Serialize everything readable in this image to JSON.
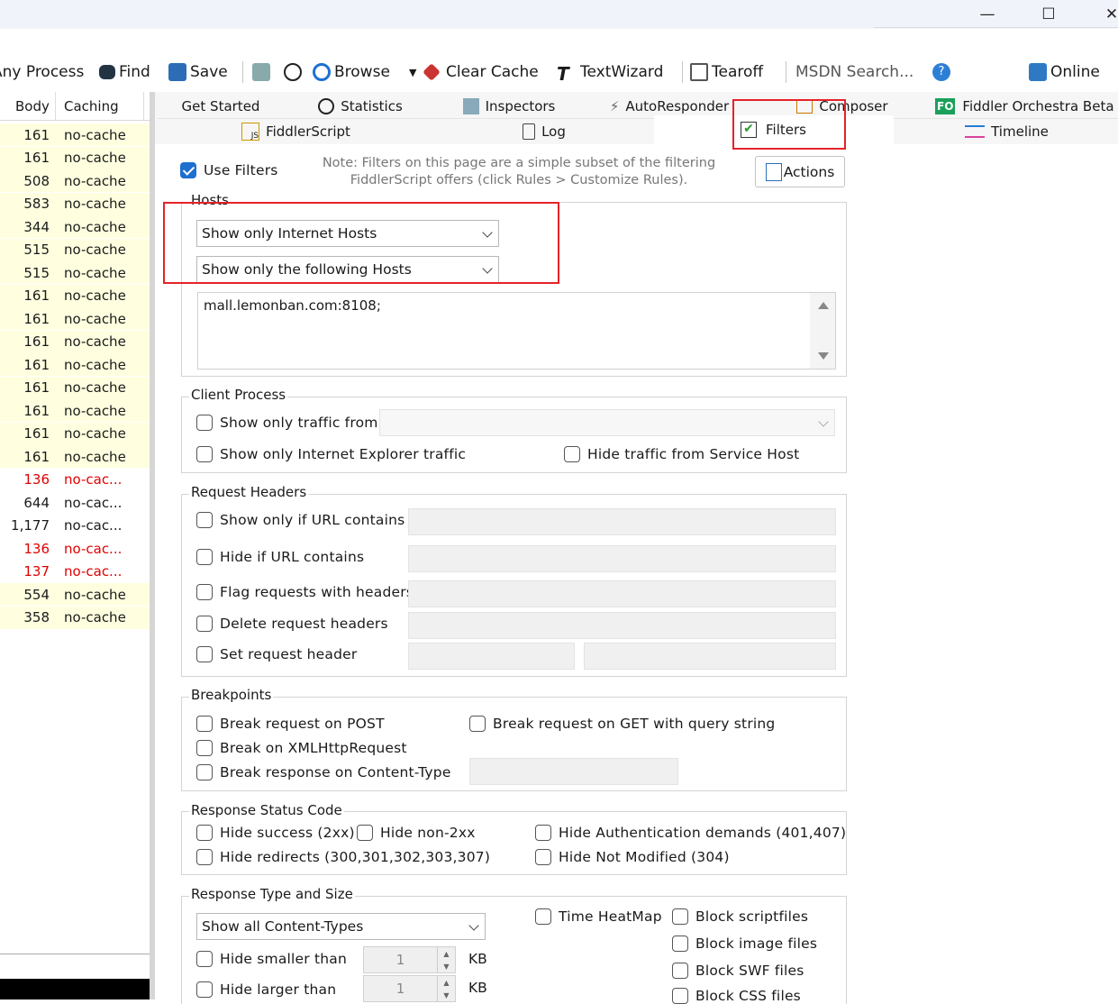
{
  "window": {
    "minimize_icon": "minimize-icon",
    "maximize_icon": "maximize-icon",
    "close_icon": "close-icon"
  },
  "toolbar": {
    "any_process": "Any Process",
    "find": "Find",
    "save": "Save",
    "browse": "Browse",
    "clear_cache": "Clear Cache",
    "textwizard": "TextWizard",
    "tearoff": "Tearoff",
    "msdn_search": "MSDN Search...",
    "online": "Online"
  },
  "sessions": {
    "columns": [
      "Body",
      "Caching"
    ],
    "rows": [
      {
        "body": "161",
        "caching": "no-cache",
        "style": "yellow"
      },
      {
        "body": "161",
        "caching": "no-cache",
        "style": "yellow"
      },
      {
        "body": "508",
        "caching": "no-cache",
        "style": "yellow"
      },
      {
        "body": "583",
        "caching": "no-cache",
        "style": "yellow"
      },
      {
        "body": "344",
        "caching": "no-cache",
        "style": "yellow"
      },
      {
        "body": "515",
        "caching": "no-cache",
        "style": "yellow"
      },
      {
        "body": "515",
        "caching": "no-cache",
        "style": "yellow"
      },
      {
        "body": "161",
        "caching": "no-cache",
        "style": "yellow"
      },
      {
        "body": "161",
        "caching": "no-cache",
        "style": "yellow"
      },
      {
        "body": "161",
        "caching": "no-cache",
        "style": "yellow"
      },
      {
        "body": "161",
        "caching": "no-cache",
        "style": "yellow"
      },
      {
        "body": "161",
        "caching": "no-cache",
        "style": "yellow"
      },
      {
        "body": "161",
        "caching": "no-cache",
        "style": "yellow"
      },
      {
        "body": "161",
        "caching": "no-cache",
        "style": "yellow"
      },
      {
        "body": "161",
        "caching": "no-cache",
        "style": "yellow"
      },
      {
        "body": "136",
        "caching": "no-cac...",
        "style": "red"
      },
      {
        "body": "644",
        "caching": "no-cac...",
        "style": "plain"
      },
      {
        "body": "1,177",
        "caching": "no-cac...",
        "style": "plain"
      },
      {
        "body": "136",
        "caching": "no-cac...",
        "style": "red"
      },
      {
        "body": "137",
        "caching": "no-cac...",
        "style": "red"
      },
      {
        "body": "554",
        "caching": "no-cache",
        "style": "yellow"
      },
      {
        "body": "358",
        "caching": "no-cache",
        "style": "yellow"
      }
    ]
  },
  "tabs": {
    "row1": [
      "Get Started",
      "Statistics",
      "Inspectors",
      "AutoResponder",
      "Composer",
      "Fiddler Orchestra Beta"
    ],
    "row2": [
      "FiddlerScript",
      "Log",
      "Filters",
      "Timeline"
    ],
    "fo_badge": "FO"
  },
  "filters": {
    "use_filters": "Use Filters",
    "note": "Note: Filters on this page are a simple subset of the filtering FiddlerScript offers (click Rules > Customize Rules).",
    "note_line1": "Note: Filters on this page are a simple subset of the filtering",
    "note_line2": "FiddlerScript offers (click Rules > Customize Rules).",
    "actions": "Actions",
    "hosts": {
      "label": "Hosts",
      "zone": "Show only Internet Hosts",
      "mode": "Show only the following Hosts",
      "list": "mall.lemonban.com:8108;"
    },
    "client_process": {
      "label": "Client Process",
      "show_traffic_from": "Show only traffic from",
      "ie_only": "Show only Internet Explorer traffic",
      "hide_service_host": "Hide traffic from Service Host"
    },
    "request_headers": {
      "label": "Request Headers",
      "url_contains": "Show only if URL contains",
      "hide_url": "Hide if URL contains",
      "flag_headers": "Flag requests with headers",
      "delete_headers": "Delete request headers",
      "set_header": "Set request header"
    },
    "breakpoints": {
      "label": "Breakpoints",
      "post": "Break request on POST",
      "get_query": "Break request on GET with query string",
      "xhr": "Break on XMLHttpRequest",
      "content_type": "Break response on Content-Type"
    },
    "status_code": {
      "label": "Response Status Code",
      "hide_success": "Hide success (2xx)",
      "hide_non2xx": "Hide non-2xx",
      "hide_auth": "Hide Authentication demands (401,407)",
      "hide_redirects": "Hide redirects (300,301,302,303,307)",
      "hide_not_modified": "Hide Not Modified (304)"
    },
    "type_size": {
      "label": "Response Type and Size",
      "content_types": "Show all Content-Types",
      "time_heatmap": "Time HeatMap",
      "block_script": "Block scriptfiles",
      "block_image": "Block image files",
      "block_swf": "Block SWF files",
      "block_css": "Block CSS files",
      "hide_smaller": "Hide smaller than",
      "hide_larger": "Hide larger than",
      "smaller_value": "1",
      "larger_value": "1",
      "unit": "KB"
    }
  },
  "colors": {
    "highlight": "#e5222a",
    "checkbox": "#1f6fd1",
    "row_yellow": "#ffffe0",
    "row_red": "#e00000"
  }
}
